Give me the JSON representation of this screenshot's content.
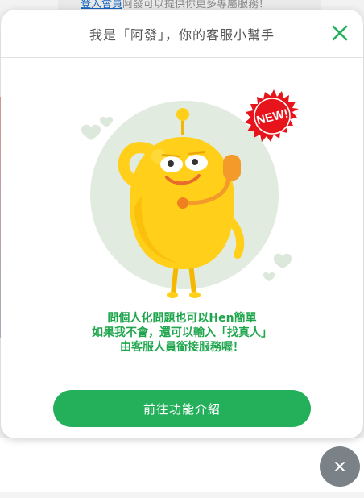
{
  "background": {
    "top_link": "登入會員",
    "top_text": "阿發可以提供你更多專屬服務！"
  },
  "modal": {
    "title": "我是「阿發」，你的客服小幫手",
    "close_icon": "close-icon",
    "badge_text": "NEW!",
    "message_lines": [
      "問個人化問題也可以Hen簡單",
      "如果我不會，還可以輸入「找真人」",
      "由客服人員銜接服務喔！"
    ],
    "cta_label": "前往功能介紹"
  },
  "floating_close": {
    "icon": "close-icon"
  },
  "colors": {
    "accent_green": "#24b05a",
    "message_green": "#1fa64d",
    "badge_red": "#e8141c",
    "mascot_yellow": "#ffcf1a",
    "circle_bg": "#e2ebe0",
    "float_button": "#7a8287"
  }
}
